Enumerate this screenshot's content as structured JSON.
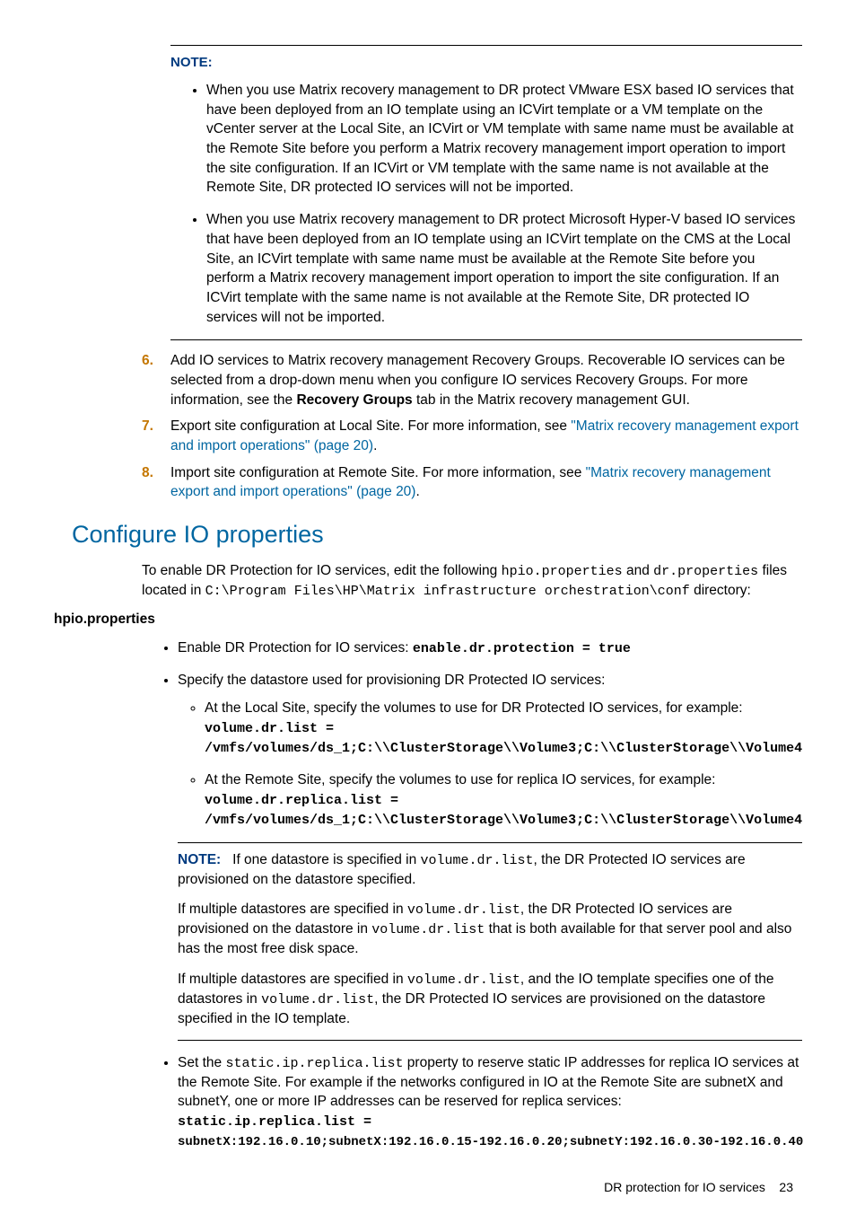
{
  "noteBlock": {
    "label": "NOTE:",
    "items": [
      "When you use Matrix recovery management to DR protect VMware ESX based IO services that have been deployed from an IO template using an ICVirt template or a VM template on the vCenter server at the Local Site, an ICVirt or VM template with same name must be available at the Remote Site before you perform a Matrix recovery management import operation to import the site configuration. If an ICVirt or VM template with the same name is not available at the Remote Site, DR protected IO services will not be imported.",
      "When you use Matrix recovery management to DR protect Microsoft Hyper-V based IO services that have been deployed from an IO template using an ICVirt template on the CMS at the Local Site, an ICVirt template with same name must be available at the Remote Site before you perform a Matrix recovery management import operation to import the site configuration. If an ICVirt template with the same name is not available at the Remote Site, DR protected IO services will not be imported."
    ]
  },
  "steps": {
    "six": {
      "num": "6.",
      "pre": "Add IO services to Matrix recovery management Recovery Groups. Recoverable IO services can be selected from a drop-down menu when you configure IO services Recovery Groups. For more information, see the ",
      "bold": "Recovery Groups",
      "post": " tab in the Matrix recovery management GUI."
    },
    "seven": {
      "num": "7.",
      "pre": "Export site configuration at Local Site. For more information, see ",
      "link": "\"Matrix recovery management export and import operations\" (page 20)",
      "post": "."
    },
    "eight": {
      "num": "8.",
      "pre": "Import site configuration at Remote Site. For more information, see ",
      "link": "\"Matrix recovery management export and import operations\" (page 20)",
      "post": "."
    }
  },
  "section": {
    "title": "Configure IO properties",
    "intro": {
      "p1a": "To enable DR Protection for IO services, edit the following ",
      "c1": "hpio.properties",
      "p1b": " and ",
      "c2": "dr.properties",
      "p1c": " files located in ",
      "c3": "C:\\Program Files\\HP\\Matrix infrastructure orchestration\\conf",
      "p1d": " directory:"
    },
    "subhead": "hpio.properties",
    "b1": {
      "text": "Enable DR Protection for IO services: ",
      "code": "enable.dr.protection = true"
    },
    "b2": {
      "text": "Specify the datastore used for provisioning DR Protected IO services:",
      "sub1": {
        "text": "At the Local Site, specify the volumes to use for DR Protected IO services, for example:",
        "code1": "volume.dr.list =",
        "code2": "/vmfs/volumes/ds_1;C:\\\\ClusterStorage\\\\Volume3;C:\\\\ClusterStorage\\\\Volume4"
      },
      "sub2": {
        "text": "At the Remote Site, specify the volumes to use for replica IO services, for example:",
        "code1": "volume.dr.replica.list =",
        "code2": "/vmfs/volumes/ds_1;C:\\\\ClusterStorage\\\\Volume3;C:\\\\ClusterStorage\\\\Volume4"
      }
    },
    "note2": {
      "label": "NOTE:",
      "p1a": "If one datastore is specified in ",
      "c1": "volume.dr.list",
      "p1b": ", the DR Protected IO services are provisioned on the datastore specified.",
      "p2a": "If multiple datastores are specified in ",
      "c2": "volume.dr.list",
      "p2b": ", the DR Protected IO services are provisioned on the datastore in ",
      "c3": "volume.dr.list",
      "p2c": " that is both available for that server pool and also has the most free disk space.",
      "p3a": "If multiple datastores are specified in ",
      "c4": "volume.dr.list",
      "p3b": ", and the IO template specifies one of the datastores in ",
      "c5": "volume.dr.list",
      "p3c": ", the DR Protected IO services are provisioned on the datastore specified in the IO template."
    },
    "b3": {
      "t1": "Set the ",
      "c1": "static.ip.replica.list",
      "t2": " property to reserve static IP addresses for replica IO services at the Remote Site. For example if the networks configured in IO at the Remote Site are subnetX and subnetY, one or more IP addresses can be reserved for replica services:",
      "code1": "static.ip.replica.list =",
      "code2": "subnetX:192.16.0.10;subnetX:192.16.0.15-192.16.0.20;subnetY:192.16.0.30-192.16.0.40"
    }
  },
  "footer": {
    "text": "DR protection for IO services",
    "page": "23"
  }
}
